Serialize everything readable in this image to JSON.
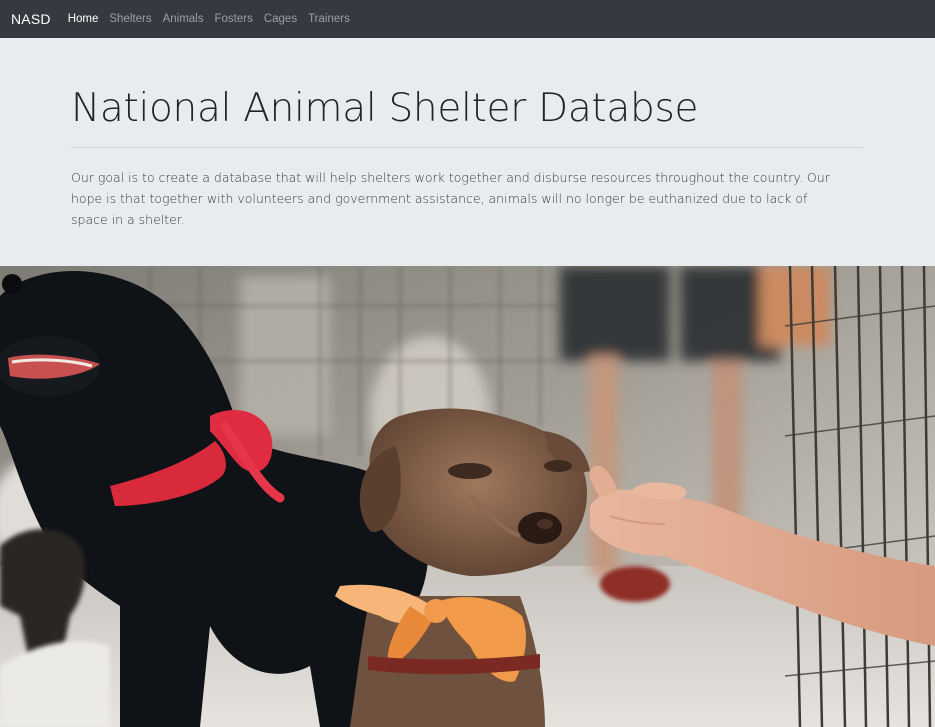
{
  "navbar": {
    "brand": "NASD",
    "items": [
      {
        "label": "Home",
        "active": true
      },
      {
        "label": "Shelters",
        "active": false
      },
      {
        "label": "Animals",
        "active": false
      },
      {
        "label": "Fosters",
        "active": false
      },
      {
        "label": "Cages",
        "active": false
      },
      {
        "label": "Trainers",
        "active": false
      }
    ]
  },
  "jumbotron": {
    "title": "National Animal Shelter Databse",
    "lead": "Our goal is to create a database that will help shelters work together and disburse resources throughout the country. Our hope is that together with volunteers and government assistance, animals will no longer be euthanized due to lack of space in a shelter."
  },
  "hero_image": {
    "subject": "puppies-at-shelter-photo"
  },
  "colors": {
    "navbar_bg": "#343a40",
    "jumbotron_bg": "#e9ecef",
    "nav_active": "#ffffff",
    "nav_inactive": "rgba(255,255,255,0.5)"
  }
}
